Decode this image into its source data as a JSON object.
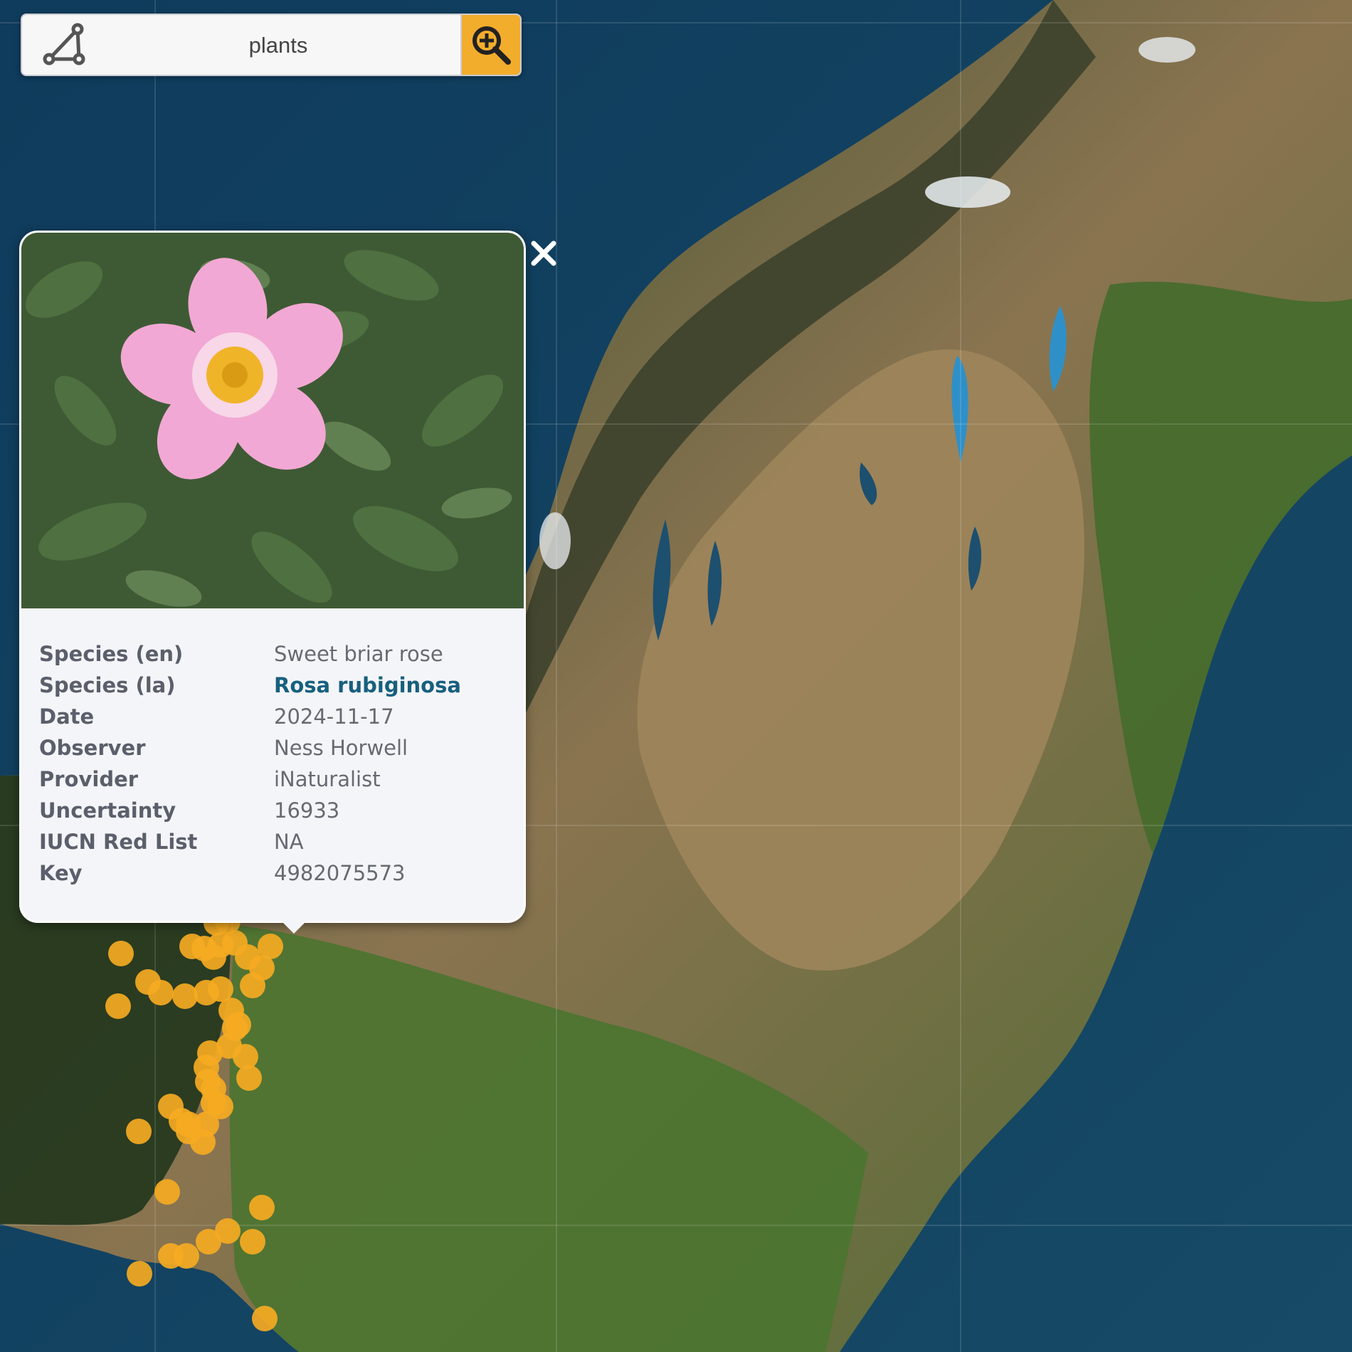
{
  "search": {
    "value": "plants",
    "draw_tool_icon": "polygon-draw-icon",
    "search_icon": "zoom-in-search-icon",
    "accent_color": "#f3ad2c"
  },
  "popup": {
    "image_subject": "pink rose flower photo",
    "close_icon": "close-icon",
    "rows": [
      {
        "label": "Species (en)",
        "value": "Sweet briar rose"
      },
      {
        "label": "Species (la)",
        "value": "Rosa rubiginosa"
      },
      {
        "label": "Date",
        "value": "2024-11-17"
      },
      {
        "label": "Observer",
        "value": "Ness Horwell"
      },
      {
        "label": "Provider",
        "value": "iNaturalist"
      },
      {
        "label": "Uncertainty",
        "value": "16933"
      },
      {
        "label": "IUCN Red List",
        "value": "NA"
      },
      {
        "label": "Key",
        "value": "4982075573"
      }
    ],
    "link_color": "#17607e"
  },
  "map": {
    "marker_color": "#f5aa22"
  }
}
